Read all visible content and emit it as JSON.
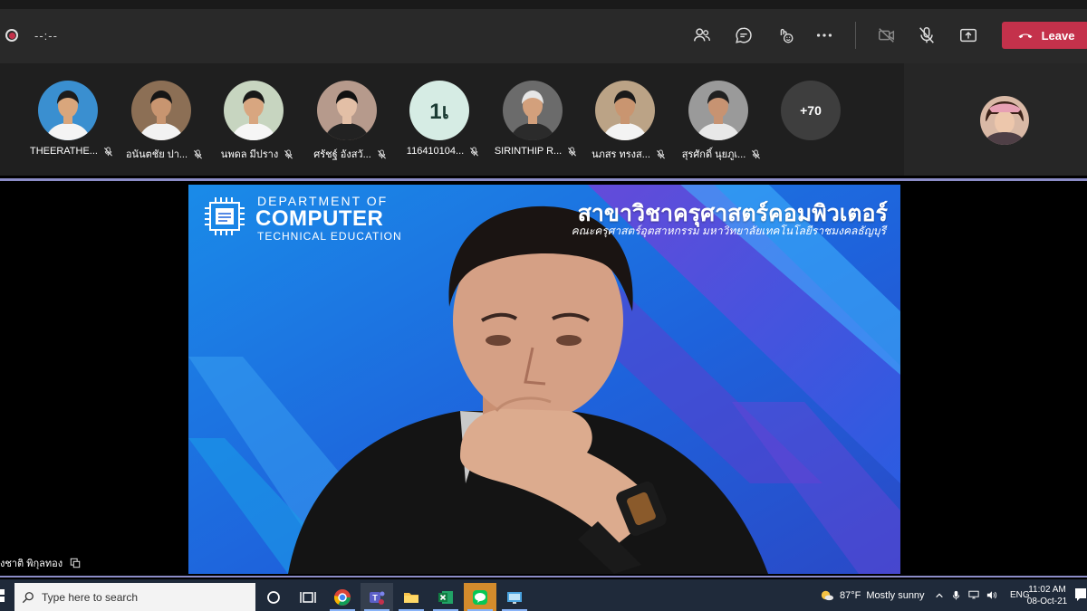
{
  "meeting": {
    "timer": "--:--",
    "leave_label": "Leave",
    "controls": [
      "people-icon",
      "chat-icon",
      "reactions-icon",
      "more-icon",
      "camera-off-icon",
      "mic-off-icon",
      "share-icon"
    ]
  },
  "participants": [
    {
      "name": "THEERATHE...",
      "type": "photo",
      "bg": "#3a8fd0",
      "shirt": "#f4f4f4",
      "skin": "#d9a67c",
      "hair": "#1c1c1c"
    },
    {
      "name": "อนันตชัย ปา...",
      "type": "photo",
      "bg": "#8c6f55",
      "shirt": "#f2f2f2",
      "skin": "#c89570",
      "hair": "#151515"
    },
    {
      "name": "นพดล มีปราง",
      "type": "photo",
      "bg": "#c7d5c0",
      "shirt": "#f6f6f6",
      "skin": "#d8a680",
      "hair": "#181818"
    },
    {
      "name": "ศรัชฐ์ อังสวั...",
      "type": "photo",
      "bg": "#b69a8c",
      "shirt": "#222222",
      "skin": "#e3bfa6",
      "hair": "#111111"
    },
    {
      "name": "116410104...",
      "type": "initials",
      "initials": "1เ"
    },
    {
      "name": "SIRINTHIP R...",
      "type": "photo",
      "bg": "#6b6b6b",
      "shirt": "#2b2b2b",
      "skin": "#d3a07c",
      "hair": "#e6e6e6"
    },
    {
      "name": "นภสร ทรงส...",
      "type": "photo",
      "bg": "#bba386",
      "shirt": "#f3f3f3",
      "skin": "#c99570",
      "hair": "#1a1a1a"
    },
    {
      "name": "สุรศักดิ์ นุยภูเ...",
      "type": "photo",
      "bg": "#9a9a9a",
      "shirt": "#e8e8e8",
      "skin": "#c79372",
      "hair": "#202020"
    }
  ],
  "overflow_count": "+70",
  "presentation": {
    "dept_line1": "DEPARTMENT OF",
    "dept_line2": "COMPUTER",
    "dept_line3": "TECHNICAL EDUCATION",
    "thai_title": "สาขาวิชาครุศาสตร์คอมพิวเตอร์",
    "thai_subtitle": "คณะครุศาสตร์อุตสาหกรรม มหาวิทยาลัยเทคโนโลยีราชมงคลธัญบุรี"
  },
  "speaker": {
    "name": "งชาติ พิกุลทอง"
  },
  "taskbar": {
    "search_placeholder": "Type here to search",
    "weather_temp": "87°F",
    "weather_text": "Mostly sunny",
    "language": "ENG",
    "time": "11:02 AM",
    "date": "08-Oct-21"
  },
  "colors": {
    "leave": "#c4314b",
    "accent_line": "#8b8cc7",
    "stage_blue": "#1f6fe0"
  }
}
